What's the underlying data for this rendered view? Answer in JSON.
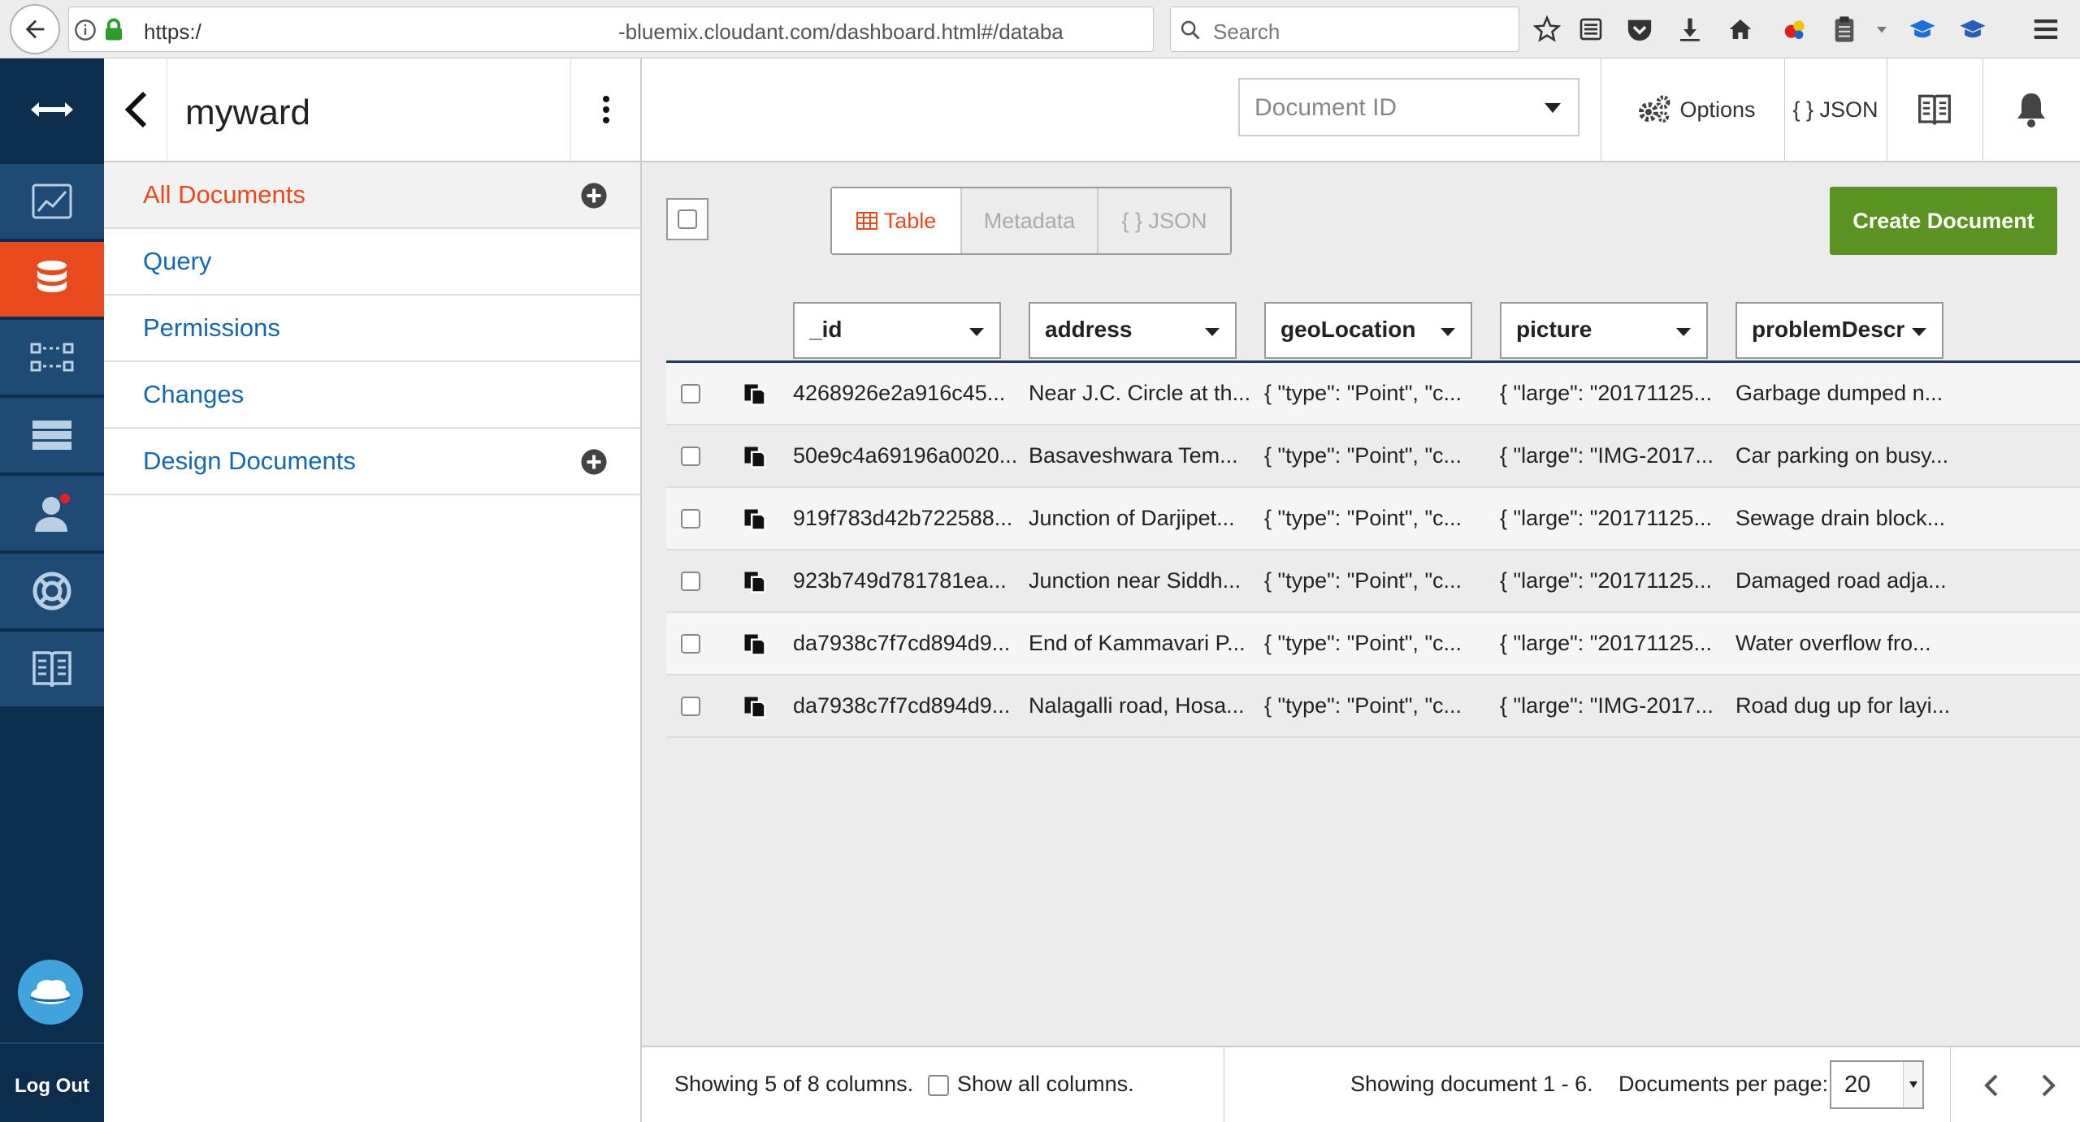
{
  "browser": {
    "url_protocol": "https:/",
    "url_host_rest": "-bluemix.cloudant.com/dashboard.html#/databa",
    "search_placeholder": "Search"
  },
  "rail": {
    "items": [
      "toggle",
      "monitoring",
      "databases",
      "replication",
      "account",
      "support",
      "documentation"
    ],
    "active": "databases",
    "logout_label": "Log Out"
  },
  "sidebar": {
    "db_name": "myward",
    "nav": [
      {
        "label": "All Documents",
        "active": true
      },
      {
        "label": "Query"
      },
      {
        "label": "Permissions"
      },
      {
        "label": "Changes"
      },
      {
        "label": "Design Documents"
      }
    ]
  },
  "toolbar": {
    "docid_placeholder": "Document ID",
    "options_label": "Options",
    "json_label": "{ } JSON"
  },
  "views": {
    "table_label": "Table",
    "metadata_label": "Metadata",
    "json_label": "{ } JSON",
    "create_label": "Create Document"
  },
  "table": {
    "columns": [
      "_id",
      "address",
      "geoLocation",
      "picture",
      "problemDescri..."
    ],
    "rows": [
      [
        "4268926e2a916c45...",
        "Near J.C. Circle at th...",
        "{ \"type\": \"Point\", \"c...",
        "{ \"large\": \"20171125...",
        "Garbage dumped n..."
      ],
      [
        "50e9c4a69196a0020...",
        "Basaveshwara Tem...",
        "{ \"type\": \"Point\", \"c...",
        "{ \"large\": \"IMG-2017...",
        "Car parking on busy..."
      ],
      [
        "919f783d42b722588...",
        "Junction of Darjipet...",
        "{ \"type\": \"Point\", \"c...",
        "{ \"large\": \"20171125...",
        "Sewage drain block..."
      ],
      [
        "923b749d781781ea...",
        "Junction near Siddh...",
        "{ \"type\": \"Point\", \"c...",
        "{ \"large\": \"20171125...",
        "Damaged road adja..."
      ],
      [
        "da7938c7f7cd894d9...",
        "End of Kammavari P...",
        "{ \"type\": \"Point\", \"c...",
        "{ \"large\": \"20171125...",
        "Water overflow fro..."
      ],
      [
        "da7938c7f7cd894d9...",
        "Nalagalli road, Hosa...",
        "{ \"type\": \"Point\", \"c...",
        "{ \"large\": \"IMG-2017...",
        "Road dug up for layi..."
      ]
    ]
  },
  "footer": {
    "columns_info": "Showing 5 of 8 columns.",
    "show_all_label": "Show all columns.",
    "docs_info": "Showing document 1 - 6.",
    "per_page_label": "Documents per page:",
    "per_page_value": "20"
  },
  "colors": {
    "accent": "#e8491d",
    "link": "#1467b0",
    "nav_rail": "#0d2d4c",
    "create_button": "#5a9321"
  }
}
